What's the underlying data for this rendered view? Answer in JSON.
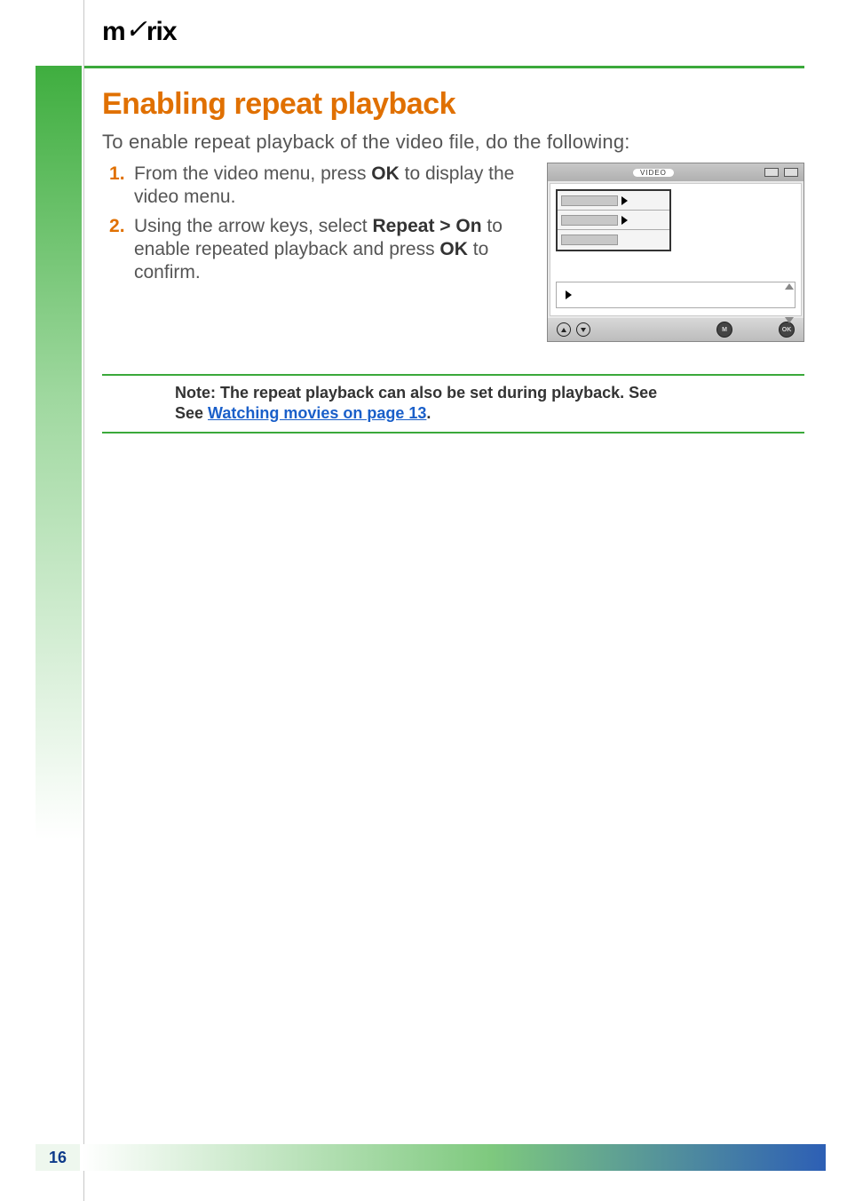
{
  "logo_text": "m✓rix",
  "heading": "Enabling repeat playback",
  "intro": "To enable repeat playback of the video file, do the following:",
  "steps": [
    {
      "pre": "From the video menu, press ",
      "bold1": "OK",
      "post1": " to display the video menu."
    },
    {
      "pre": "Using the arrow keys, select ",
      "bold1": "Repeat > On",
      "mid": " to enable repeated playback and press ",
      "bold2": "OK",
      "post2": " to confirm."
    }
  ],
  "screenshot": {
    "title_pill": "VIDEO",
    "ok_label": "OK",
    "m_label": "M"
  },
  "note": {
    "label": "Note:",
    "text": " The repeat playback can also be set during playback. See ",
    "link_text": "Watching movies on page 13",
    "after": "."
  },
  "page_number": "16"
}
